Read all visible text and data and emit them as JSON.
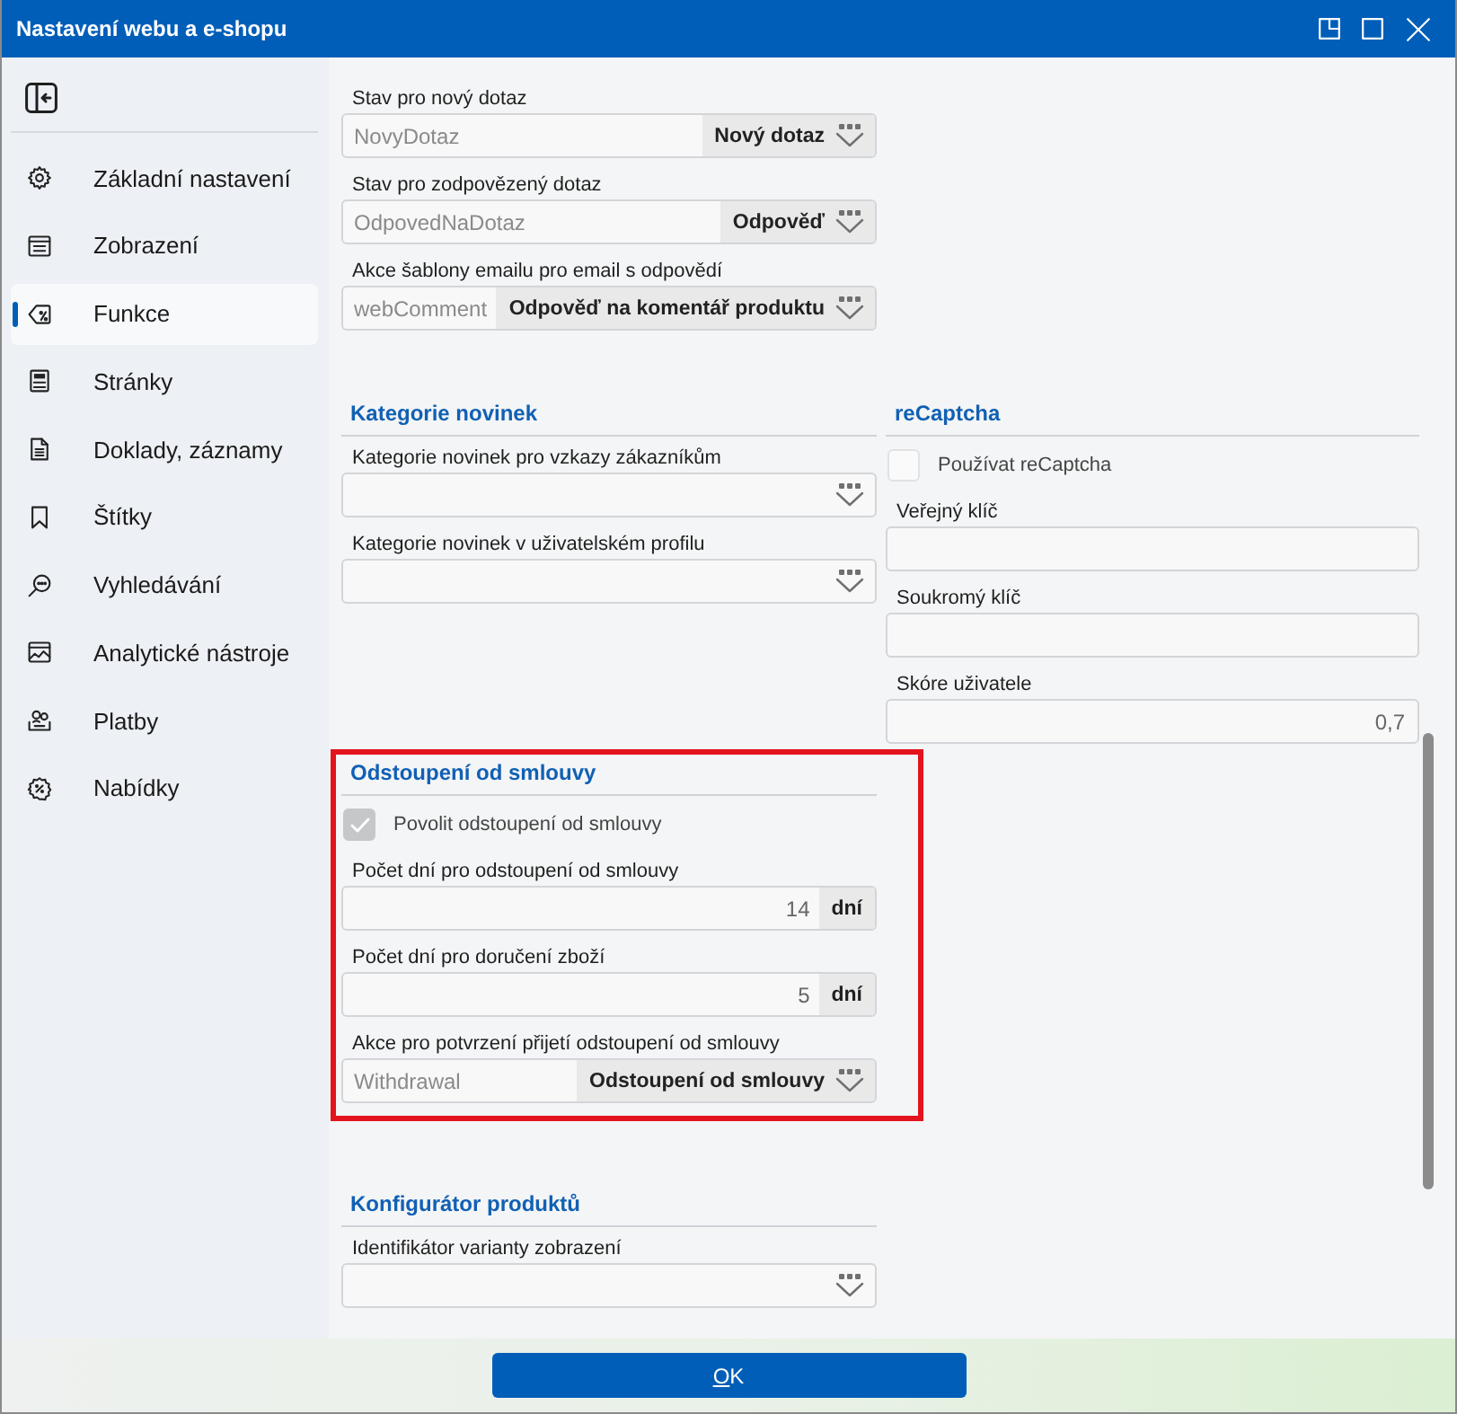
{
  "window": {
    "title": "Nastavení webu a e-shopu"
  },
  "sidebar": {
    "items": [
      {
        "label": "Základní nastavení",
        "selected": false
      },
      {
        "label": "Zobrazení",
        "selected": false
      },
      {
        "label": "Funkce",
        "selected": true
      },
      {
        "label": "Stránky",
        "selected": false
      },
      {
        "label": "Doklady, záznamy",
        "selected": false
      },
      {
        "label": "Štítky",
        "selected": false
      },
      {
        "label": "Vyhledávání",
        "selected": false
      },
      {
        "label": "Analytické nástroje",
        "selected": false
      },
      {
        "label": "Platby",
        "selected": false
      },
      {
        "label": "Nabídky",
        "selected": false
      }
    ]
  },
  "content": {
    "rows": [
      {
        "sections": [
          {
            "highlighted": false,
            "fields": [
              {
                "kind": "code-select",
                "label": "Stav pro nový dotaz",
                "value": "NovyDotaz",
                "caption": "Nový dotaz"
              },
              {
                "kind": "code-select",
                "label": "Stav pro zodpovězený dotaz",
                "value": "OdpovedNaDotaz",
                "caption": "Odpověď"
              },
              {
                "kind": "code-select",
                "label": "Akce šablony emailu pro email s odpovědí",
                "value": "webComment",
                "caption": "Odpověď na komentář produktu"
              }
            ]
          }
        ]
      },
      {
        "sections": [
          {
            "heading": "Kategorie novinek",
            "highlighted": false,
            "fields": [
              {
                "kind": "select",
                "label": "Kategorie novinek pro vzkazy zákazníkům"
              },
              {
                "kind": "select",
                "label": "Kategorie novinek v uživatelském profilu"
              }
            ]
          },
          {
            "heading": "reCaptcha",
            "highlighted": false,
            "fields": [
              {
                "kind": "checkbox",
                "label": "Používat reCaptcha",
                "checked": false
              },
              {
                "kind": "text",
                "label": "Veřejný klíč"
              },
              {
                "kind": "text",
                "label": "Soukromý klíč"
              },
              {
                "kind": "number",
                "label": "Skóre uživatele",
                "value": "0,7"
              }
            ]
          }
        ]
      },
      {
        "sections": [
          {
            "heading": "Odstoupení od smlouvy",
            "highlighted": true,
            "fields": [
              {
                "kind": "checkbox",
                "label": "Povolit odstoupení od smlouvy",
                "checked": true
              },
              {
                "kind": "quantity",
                "label": "Počet dní pro odstoupení od smlouvy",
                "amount": "14",
                "unit": "dní"
              },
              {
                "kind": "quantity",
                "label": "Počet dní pro doručení zboží",
                "amount": "5",
                "unit": "dní"
              },
              {
                "kind": "code-select",
                "label": "Akce pro potvrzení přijetí odstoupení od smlouvy",
                "value": "Withdrawal",
                "caption": "Odstoupení od smlouvy"
              }
            ]
          }
        ]
      },
      {
        "sections": [
          {
            "heading": "Konfigurátor produktů",
            "highlighted": false,
            "fields": [
              {
                "kind": "select",
                "label": "Identifikátor varianty zobrazení"
              }
            ]
          }
        ]
      }
    ]
  },
  "footer": {
    "buttons": [
      {
        "label": "OK"
      }
    ]
  }
}
